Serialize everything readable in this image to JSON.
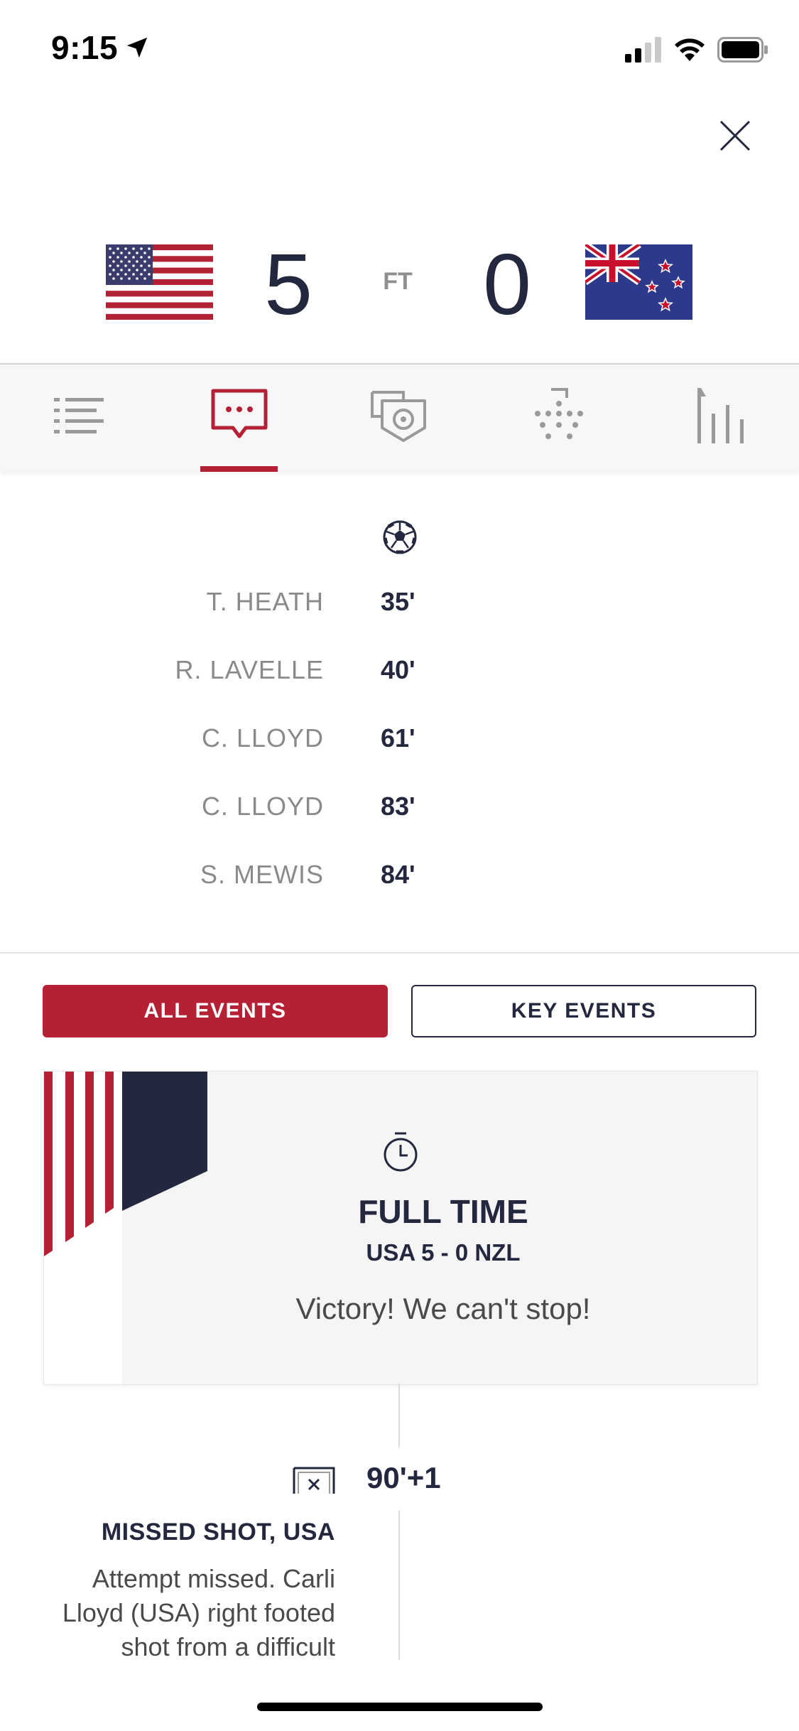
{
  "status_bar": {
    "time": "9:15"
  },
  "match": {
    "home": {
      "team": "USA",
      "score": "5"
    },
    "away": {
      "team": "NZL",
      "score": "0"
    },
    "status": "FT"
  },
  "tabs": [
    {
      "name": "list",
      "active": false
    },
    {
      "name": "commentary",
      "active": true
    },
    {
      "name": "stats",
      "active": false
    },
    {
      "name": "lineups",
      "active": false
    },
    {
      "name": "standings",
      "active": false
    }
  ],
  "goals": [
    {
      "player": "T. HEATH",
      "minute": "35'"
    },
    {
      "player": "R. LAVELLE",
      "minute": "40'"
    },
    {
      "player": "C. LLOYD",
      "minute": "61'"
    },
    {
      "player": "C. LLOYD",
      "minute": "83'"
    },
    {
      "player": "S. MEWIS",
      "minute": "84'"
    }
  ],
  "filters": {
    "all_label": "ALL EVENTS",
    "key_label": "KEY EVENTS",
    "selected": "ALL EVENTS"
  },
  "full_time_card": {
    "title": "FULL TIME",
    "subtitle": "USA 5 - 0 NZL",
    "message": "Victory! We can't stop!"
  },
  "event": {
    "minute": "90'+1",
    "title": "MISSED SHOT, USA",
    "desc_line1": "Attempt missed. Carli",
    "desc_line2": "Lloyd (USA) right footed",
    "desc_line3": "shot from a difficult"
  },
  "colors": {
    "accent": "#b62034",
    "navy": "#23283f"
  }
}
